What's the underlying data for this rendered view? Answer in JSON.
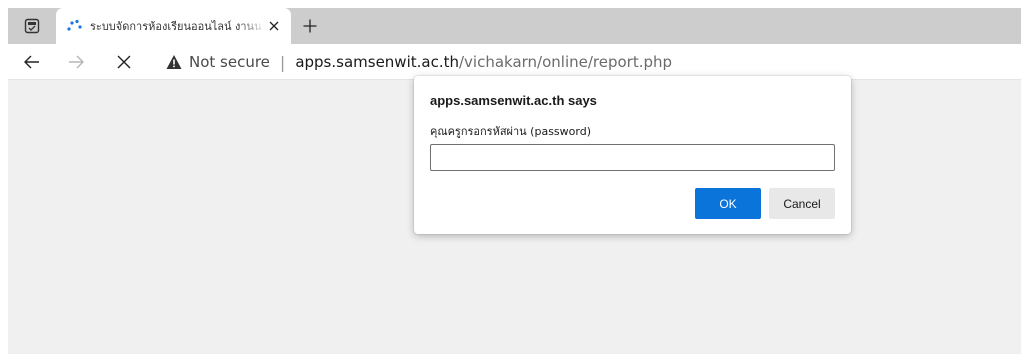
{
  "browser": {
    "tab": {
      "title": "ระบบจัดการห้องเรียนออนไลน์ งานนวัตก"
    },
    "address_bar": {
      "security_label": "Not secure",
      "url_host": "apps.samsenwit.ac.th",
      "url_path": "/vichakarn/online/report.php"
    },
    "icons": {
      "tab_actions": "tab-actions-icon",
      "loading": "loading-spinner-icon",
      "close_tab": "close-icon",
      "new_tab": "plus-icon",
      "back": "arrow-left-icon",
      "forward": "arrow-right-icon",
      "stop": "close-icon",
      "warning": "warning-icon"
    }
  },
  "dialog": {
    "title": "apps.samsenwit.ac.th says",
    "message": "คุณครูกรอกรหัสผ่าน (password)",
    "input_value": "",
    "ok_label": "OK",
    "cancel_label": "Cancel"
  },
  "colors": {
    "tabstrip_bg": "#cdcdcd",
    "page_bg": "#f0f0f0",
    "ok_button": "#0a74da",
    "spinner": "#1a73e8"
  }
}
